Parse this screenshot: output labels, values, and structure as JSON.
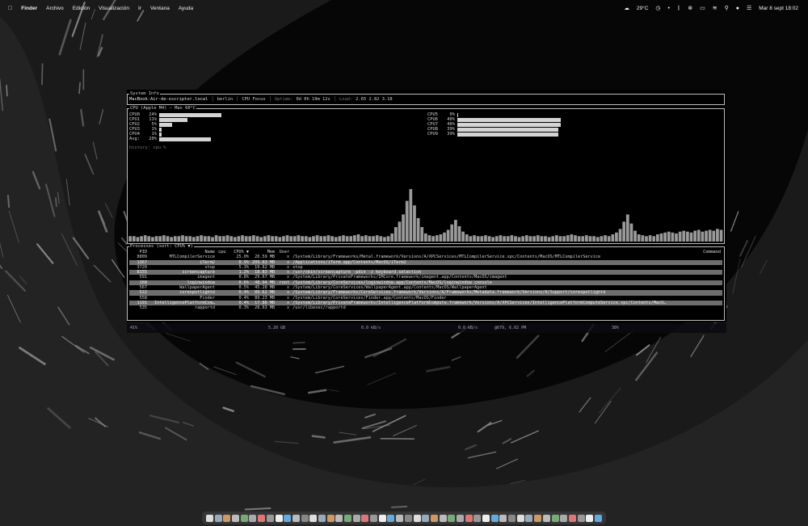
{
  "menubar": {
    "apple_icon": "apple-logo",
    "items": [
      "Finder",
      "Archivo",
      "Edición",
      "Visualización",
      "Ir",
      "Ventana",
      "Ayuda"
    ],
    "weather": "29°C",
    "datetime": "Mar 8 sept 18:02",
    "status_icons": [
      "weather-icon",
      "clock-icon",
      "dot-icon",
      "bluetooth-icon",
      "link-icon",
      "battery-icon",
      "wifi-icon",
      "search-icon",
      "user-icon",
      "control-center-icon",
      "siri-icon"
    ]
  },
  "sysinfo": {
    "title": "System Info",
    "host": "MacBook-Air-de-xscriptor.local",
    "user": "berlin",
    "mode": "CPU Focus",
    "uptime_label": "Uptime:",
    "uptime": "0d 0h 19m 12s",
    "load_label": "Load:",
    "load": "2.65 2.82 3.18"
  },
  "cpu": {
    "title": "CPU (Apple M4) — Max 60°C",
    "left": [
      {
        "name": "CPU0",
        "pct": "24%",
        "frac": 0.24
      },
      {
        "name": "CPU1",
        "pct": "11%",
        "frac": 0.11
      },
      {
        "name": "CPU2",
        "pct": "5%",
        "frac": 0.05
      },
      {
        "name": "CPU3",
        "pct": "1%",
        "frac": 0.01
      },
      {
        "name": "CPU4",
        "pct": "1%",
        "frac": 0.01
      }
    ],
    "avg": {
      "name": "Avg:",
      "pct": "20%",
      "frac": 0.2
    },
    "right": [
      {
        "name": "CPU5",
        "pct": "0%",
        "frac": 0.0
      },
      {
        "name": "CPU6",
        "pct": "40%",
        "frac": 0.4
      },
      {
        "name": "CPU7",
        "pct": "40%",
        "frac": 0.4
      },
      {
        "name": "CPU8",
        "pct": "39%",
        "frac": 0.39
      },
      {
        "name": "CPU9",
        "pct": "39%",
        "frac": 0.39
      }
    ],
    "history_label": "history: cpu %",
    "history": [
      6,
      6,
      5,
      6,
      7,
      6,
      5,
      6,
      6,
      7,
      6,
      5,
      6,
      6,
      7,
      6,
      6,
      5,
      6,
      7,
      6,
      6,
      5,
      7,
      6,
      6,
      7,
      6,
      5,
      6,
      7,
      6,
      6,
      7,
      6,
      5,
      6,
      7,
      6,
      6,
      5,
      6,
      7,
      6,
      6,
      7,
      6,
      6,
      5,
      6,
      7,
      6,
      6,
      7,
      6,
      5,
      6,
      7,
      6,
      6,
      7,
      8,
      6,
      7,
      6,
      6,
      7,
      6,
      5,
      6,
      9,
      16,
      22,
      30,
      45,
      58,
      40,
      26,
      16,
      9,
      7,
      6,
      7,
      8,
      10,
      13,
      19,
      24,
      17,
      11,
      8,
      6,
      7,
      6,
      6,
      7,
      6,
      5,
      6,
      7,
      6,
      6,
      7,
      6,
      5,
      6,
      7,
      6,
      6,
      7,
      6,
      6,
      5,
      6,
      7,
      6,
      6,
      7,
      8,
      7,
      6,
      6,
      7,
      6,
      6,
      5,
      6,
      7,
      6,
      8,
      10,
      14,
      22,
      30,
      20,
      12,
      8,
      7,
      6,
      7,
      6,
      8,
      9,
      10,
      11,
      10,
      9,
      11,
      12,
      11,
      10,
      12,
      13,
      11,
      12,
      13,
      12,
      14,
      13
    ]
  },
  "processes": {
    "title": "Processes (sort: CPU% ▼)",
    "headers": {
      "pid": "PID",
      "name": "Name",
      "cpu": "cpu",
      "cpu_pct": "CPU% ▼",
      "mem": "Mem",
      "user": "User",
      "command": "Command"
    },
    "rows": [
      {
        "pid": "8809",
        "name": "MTLCompilerService",
        "cpu": "",
        "cpu_pct": "25.0%",
        "mem": "20.59 MB",
        "user": "x",
        "command": "/System/Library/Frameworks/Metal.framework/Versions/A/XPCServices/MTLCompilerService.xpc/Contents/MacOS/MTLCompilerService"
      },
      {
        "pid": "1367",
        "name": "iTerm2",
        "cpu": "",
        "cpu_pct": "8.9%",
        "mem": "209.83 MB",
        "user": "x",
        "command": "/Applications/iTerm.app/Contents/MacOS/iTerm2"
      },
      {
        "pid": "3720",
        "name": "xtop",
        "cpu": "",
        "cpu_pct": "5.3%",
        "mem": "19.62 MB",
        "user": "x",
        "command": "xtop"
      },
      {
        "pid": "8155",
        "name": "screencapture",
        "cpu": "",
        "cpu_pct": "1.2%",
        "mem": "18.83 MB",
        "user": "x",
        "command": "/usr/sbin/screencapture -pdin -z keyboard.selection"
      },
      {
        "pid": "591",
        "name": "imagent",
        "cpu": "",
        "cpu_pct": "0.8%",
        "mem": "29.67 MB",
        "user": "x",
        "command": "/System/Library/PrivateFrameworks/IMCore.framework/imagent.app/Contents/MacOS/imagent"
      },
      {
        "pid": "168",
        "name": "loginwindow",
        "cpu": "",
        "cpu_pct": "0.6%",
        "mem": "48.94 MB",
        "user": "root",
        "command": "/System/Library/CoreServices/loginwindow.app/Contents/MacOS/loginwindow console"
      },
      {
        "pid": "567",
        "name": "WallpaperAgent",
        "cpu": "",
        "cpu_pct": "0.5%",
        "mem": "45.28 MB",
        "user": "x",
        "command": "/System/Library/CoreServices/WallpaperAgent.app/Contents/MacOS/WallpaperAgent"
      },
      {
        "pid": "522",
        "name": "corespotlightd",
        "cpu": "",
        "cpu_pct": "0.4%",
        "mem": "89.62 MB",
        "user": "x",
        "command": "/System/Library/Frameworks/CoreServices.framework/Versions/A/Frameworks/Metadata.framework/Versions/A/Support/corespotlightd"
      },
      {
        "pid": "558",
        "name": "Finder",
        "cpu": "",
        "cpu_pct": "0.4%",
        "mem": "89.23 MB",
        "user": "x",
        "command": "/System/Library/CoreServices/Finder.app/Contents/MacOS/Finder"
      },
      {
        "pid": "1191",
        "name": "IntelligencePlatformCom…",
        "cpu": "",
        "cpu_pct": "0.4%",
        "mem": "17.86 MB",
        "user": "x",
        "command": "/System/Library/PrivateFrameworks/IntelligencePlatformCompute.framework/Versions/A/XPCServices/IntelligencePlatformComputeService.xpc/Contents/MacO…"
      },
      {
        "pid": "535",
        "name": "rapportd",
        "cpu": "",
        "cpu_pct": "0.3%",
        "mem": "28.63 MB",
        "user": "x",
        "command": "/usr/libexec/rapportd"
      }
    ]
  },
  "statusbar": {
    "battery": "41%",
    "mem": "5.20 GB",
    "net_down": "0.0 kB/s",
    "net_up": "0.0 kB/s",
    "temp": "@679, 6.02 PM",
    "disk": "38%"
  }
}
